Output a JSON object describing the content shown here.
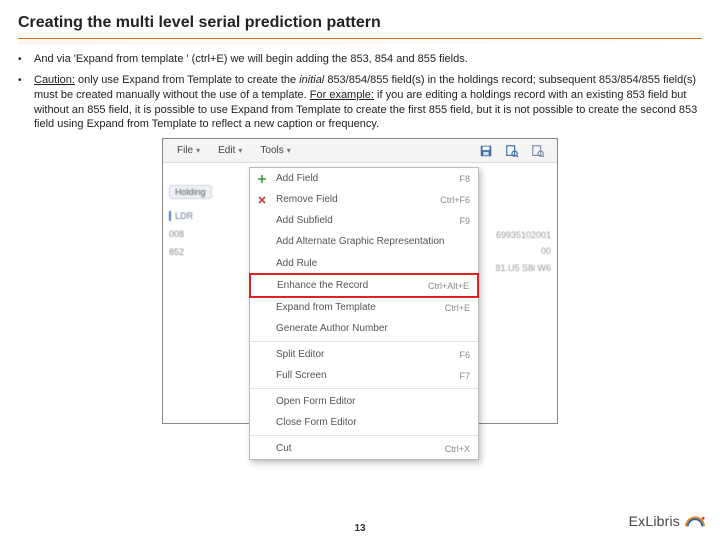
{
  "title": "Creating the multi level serial prediction pattern",
  "bullets": {
    "b1": "And via 'Expand from template ' (ctrl+E) we will begin adding the 853, 854 and 855 fields.",
    "b2_caution": "Caution:",
    "b2_rest_a": " only use Expand from Template to create the ",
    "b2_initial": "initial",
    "b2_rest_b": " 853/854/855 field(s) in the holdings record; subsequent 853/854/855 field(s) must be created manually without the use of a template. ",
    "b2_forex": "For example:",
    "b2_rest_c": " if you are editing a holdings record with an existing 853 field but without an 855 field, it is possible to use Expand from Template to create the first 855 field, but it is not possible to create the second 853 field using Expand from Template to reflect a new caption or frequency."
  },
  "toolbar": {
    "file": "File",
    "edit": "Edit",
    "tools": "Tools"
  },
  "left": {
    "tab": "Holding",
    "ldr": "LDR",
    "r1": "008",
    "r2": "852"
  },
  "menu": {
    "add_field": "Add Field",
    "add_field_sc": "F8",
    "remove_field": "Remove Field",
    "remove_field_sc": "Ctrl+F6",
    "add_subfield": "Add Subfield",
    "add_subfield_sc": "F9",
    "add_alt": "Add Alternate Graphic Representation",
    "add_rule": "Add Rule",
    "enhance": "Enhance the Record",
    "enhance_sc": "Ctrl+Alt+E",
    "expand": "Expand from Template",
    "expand_sc": "Ctrl+E",
    "gen_author": "Generate Author Number",
    "split": "Split Editor",
    "split_sc": "F6",
    "full": "Full Screen",
    "full_sc": "F7",
    "open_form": "Open Form Editor",
    "close_form": "Close Form Editor",
    "cut": "Cut",
    "cut_sc": "Ctrl+X"
  },
  "right_faint": {
    "l1": "69935102001",
    "l2": "00",
    "l3": "81.U5 S8i W6"
  },
  "page_number": "13",
  "logo": "ExLibris"
}
